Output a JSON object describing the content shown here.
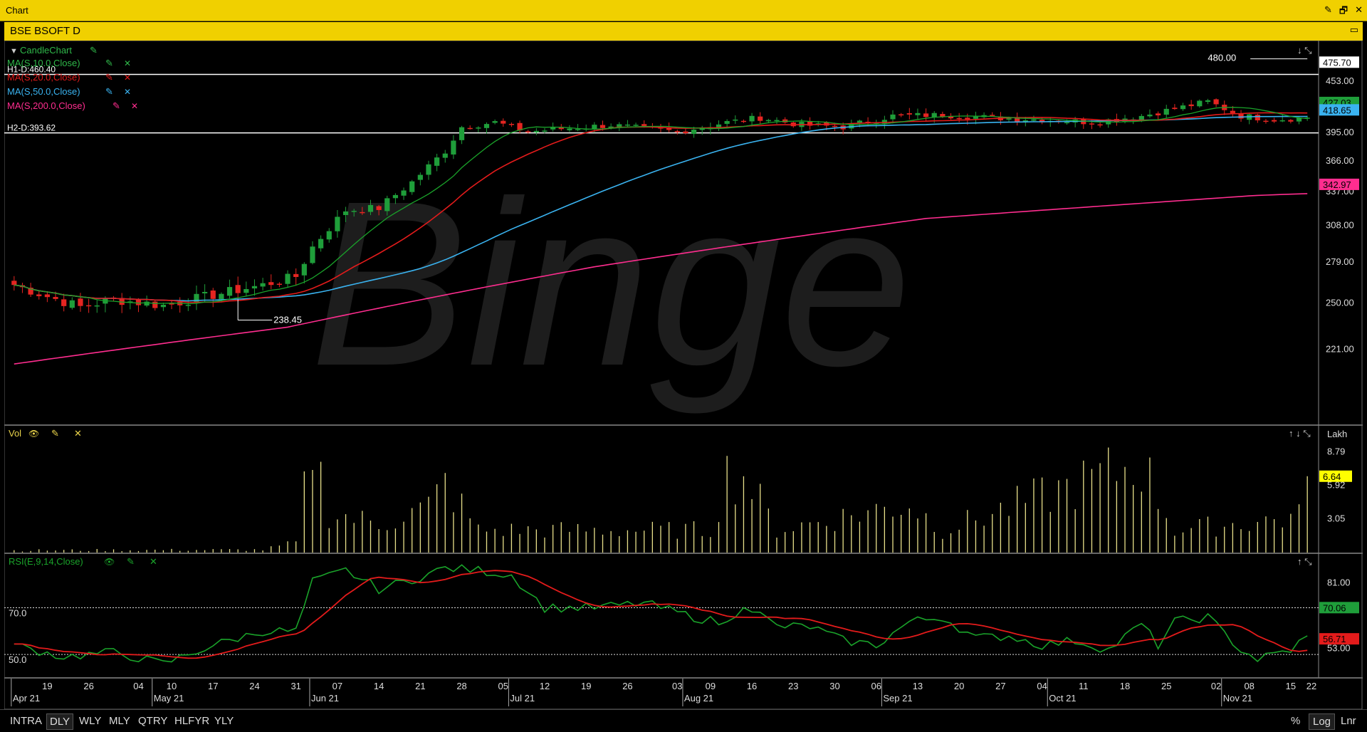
{
  "window": {
    "title": "Chart",
    "controls": [
      "✎",
      "🗗",
      "✕"
    ]
  },
  "chart_header": {
    "title": "BSE BSOFT D",
    "minimize": "▭"
  },
  "watermark": "Binge",
  "colors": {
    "up": "#1f9e3a",
    "down": "#e52521",
    "ma10": "#1aa32a",
    "ma20": "#e31b1b",
    "ma50": "#3ab3f0",
    "ma200": "#ff2d8f",
    "volume": "#e8e08a",
    "rsi": "#1aa32a",
    "rsiSignal": "#e31b1b",
    "grid": "#ffffff"
  },
  "price_panel": {
    "legend": [
      {
        "label": "CandleChart",
        "color": "#2fb84a"
      },
      {
        "label": "MA(S,10.0,Close)",
        "color": "#2fb84a"
      },
      {
        "label": "MA(S,20.0,Close)",
        "color": "#e31b1b"
      },
      {
        "label": "MA(S,50.0,Close)",
        "color": "#3ab3f0"
      },
      {
        "label": "MA(S,200.0,Close)",
        "color": "#ff2d8f"
      }
    ],
    "hlines": [
      {
        "label": "H1-D:460.40",
        "value": 460.4
      },
      {
        "label": "H2-D:393.62",
        "value": 393.62
      }
    ],
    "high_annotation": "480.00",
    "low_annotation": "238.45",
    "axis_ticks": [
      "453.00",
      "395.00",
      "366.00",
      "337.00",
      "308.00",
      "279.00",
      "250.00",
      "221.00"
    ],
    "axis_tick_values": [
      453,
      395,
      366,
      337,
      308,
      279,
      250,
      221
    ],
    "ylim": [
      180,
      504
    ],
    "value_tags": [
      {
        "text": "475.70",
        "value": 475.7,
        "bg": "#ffffff",
        "fg": "#000000"
      },
      {
        "text": "427.03",
        "value": 427.03,
        "bg": "#1f9e3a",
        "fg": "#000000"
      },
      {
        "text": "418.65",
        "value": 418.65,
        "bg": "#3ab3f0",
        "fg": "#000000"
      },
      {
        "text": "342.97",
        "value": 342.97,
        "bg": "#ff2d8f",
        "fg": "#000000"
      }
    ],
    "panel_icons": "↓ ⤡"
  },
  "volume_panel": {
    "legend": "Vol",
    "unit": "Lakh",
    "axis_ticks": [
      "8.79",
      "5.92",
      "3.05"
    ],
    "axis_tick_values": [
      8.79,
      5.92,
      3.05
    ],
    "ylim": [
      0,
      10
    ],
    "value_tag": {
      "text": "6.64",
      "value": 6.64,
      "bg": "#ffff00",
      "fg": "#000000"
    },
    "panel_icons": "↑ ↓ ⤡"
  },
  "rsi_panel": {
    "legend": "RSI(E,9,14,Close)",
    "axis_ticks": [
      "81.00",
      "53.00"
    ],
    "axis_tick_values": [
      81,
      53
    ],
    "ylim": [
      40,
      93
    ],
    "levels": [
      {
        "label": "70.0",
        "value": 70
      },
      {
        "label": "50.0",
        "value": 50
      }
    ],
    "value_tags": [
      {
        "text": "70.06",
        "value": 70.06,
        "bg": "#1f9e3a",
        "fg": "#000000"
      },
      {
        "text": "56.71",
        "value": 56.71,
        "bg": "#e31b1b",
        "fg": "#000000"
      }
    ],
    "panel_icons": "↑ ⤡"
  },
  "x_axis": {
    "labels": [
      {
        "text": "Apr 21",
        "date": "2021-04-13"
      },
      {
        "text": "19",
        "date": "2021-04-19"
      },
      {
        "text": "26",
        "date": "2021-04-26"
      },
      {
        "text": "04",
        "date": "2021-05-04"
      },
      {
        "text": "May 21",
        "date": "2021-05-06"
      },
      {
        "text": "10",
        "date": "2021-05-10"
      },
      {
        "text": "17",
        "date": "2021-05-17"
      },
      {
        "text": "24",
        "date": "2021-05-24"
      },
      {
        "text": "31",
        "date": "2021-05-31"
      },
      {
        "text": "Jun 21",
        "date": "2021-06-02"
      },
      {
        "text": "07",
        "date": "2021-06-07"
      },
      {
        "text": "14",
        "date": "2021-06-14"
      },
      {
        "text": "21",
        "date": "2021-06-21"
      },
      {
        "text": "28",
        "date": "2021-06-28"
      },
      {
        "text": "05",
        "date": "2021-07-05"
      },
      {
        "text": "Jul 21",
        "date": "2021-07-06"
      },
      {
        "text": "12",
        "date": "2021-07-12"
      },
      {
        "text": "19",
        "date": "2021-07-19"
      },
      {
        "text": "26",
        "date": "2021-07-26"
      },
      {
        "text": "03",
        "date": "2021-08-03"
      },
      {
        "text": "Aug 21",
        "date": "2021-08-04"
      },
      {
        "text": "09",
        "date": "2021-08-09"
      },
      {
        "text": "16",
        "date": "2021-08-16"
      },
      {
        "text": "23",
        "date": "2021-08-23"
      },
      {
        "text": "30",
        "date": "2021-08-30"
      },
      {
        "text": "06",
        "date": "2021-09-06"
      },
      {
        "text": "Sep 21",
        "date": "2021-09-07"
      },
      {
        "text": "13",
        "date": "2021-09-13"
      },
      {
        "text": "20",
        "date": "2021-09-20"
      },
      {
        "text": "27",
        "date": "2021-09-27"
      },
      {
        "text": "04",
        "date": "2021-10-04"
      },
      {
        "text": "Oct 21",
        "date": "2021-10-05"
      },
      {
        "text": "11",
        "date": "2021-10-11"
      },
      {
        "text": "18",
        "date": "2021-10-18"
      },
      {
        "text": "25",
        "date": "2021-10-25"
      },
      {
        "text": "02",
        "date": "2021-11-02"
      },
      {
        "text": "Nov 21",
        "date": "2021-11-03"
      },
      {
        "text": "08",
        "date": "2021-11-08"
      },
      {
        "text": "15",
        "date": "2021-11-15"
      },
      {
        "text": "22",
        "date": "2021-11-22"
      }
    ]
  },
  "chart_data": {
    "type": "candlestick",
    "start_date": "2021-04-13",
    "end_date": "2021-11-17",
    "anchors": {
      "close": [
        [
          0,
          262
        ],
        [
          4,
          254
        ],
        [
          8,
          247
        ],
        [
          12,
          252
        ],
        [
          18,
          248
        ],
        [
          24,
          255
        ],
        [
          30,
          262
        ],
        [
          34,
          268
        ],
        [
          36,
          290
        ],
        [
          40,
          320
        ],
        [
          44,
          322
        ],
        [
          48,
          345
        ],
        [
          52,
          375
        ],
        [
          54,
          400
        ],
        [
          58,
          405
        ],
        [
          62,
          395
        ],
        [
          66,
          398
        ],
        [
          72,
          402
        ],
        [
          76,
          398
        ],
        [
          80,
          395
        ],
        [
          86,
          405
        ],
        [
          90,
          410
        ],
        [
          95,
          402
        ],
        [
          100,
          400
        ],
        [
          106,
          412
        ],
        [
          112,
          413
        ],
        [
          118,
          410
        ],
        [
          124,
          408
        ],
        [
          130,
          405
        ],
        [
          136,
          412
        ],
        [
          140,
          420
        ],
        [
          144,
          428
        ],
        [
          148,
          412
        ],
        [
          152,
          408
        ],
        [
          156,
          410
        ],
        [
          160,
          415
        ],
        [
          164,
          412
        ],
        [
          166,
          420
        ],
        [
          168,
          415
        ],
        [
          170,
          402
        ],
        [
          172,
          404
        ],
        [
          176,
          408
        ],
        [
          180,
          414
        ],
        [
          182,
          415
        ],
        [
          185,
          430
        ],
        [
          187,
          452
        ],
        [
          189,
          471
        ]
      ],
      "volume": [
        [
          0,
          0.25
        ],
        [
          30,
          0.3
        ],
        [
          34,
          0.9
        ],
        [
          36,
          9.6
        ],
        [
          38,
          3.5
        ],
        [
          44,
          2.5
        ],
        [
          50,
          4.0
        ],
        [
          52,
          6.0
        ],
        [
          56,
          2.0
        ],
        [
          84,
          2.0
        ],
        [
          86,
          6.8
        ],
        [
          88,
          6.8
        ],
        [
          92,
          2.0
        ],
        [
          108,
          4.3
        ],
        [
          112,
          2.0
        ],
        [
          136,
          7.8
        ],
        [
          140,
          2.0
        ],
        [
          164,
          3.8
        ],
        [
          168,
          1.0
        ],
        [
          184,
          1.0
        ],
        [
          186,
          4.5
        ],
        [
          188,
          1.2
        ],
        [
          189,
          6.64
        ]
      ],
      "ma200": [
        [
          0,
          212
        ],
        [
          33,
          234
        ],
        [
          70,
          275
        ],
        [
          110,
          313
        ],
        [
          150,
          333
        ],
        [
          189,
          342.97
        ]
      ],
      "rsi": [
        [
          0,
          54
        ],
        [
          6,
          49
        ],
        [
          12,
          51
        ],
        [
          18,
          46
        ],
        [
          24,
          54
        ],
        [
          30,
          60
        ],
        [
          34,
          60
        ],
        [
          36,
          81
        ],
        [
          40,
          86
        ],
        [
          44,
          78
        ],
        [
          48,
          82
        ],
        [
          52,
          87
        ],
        [
          56,
          86
        ],
        [
          60,
          84
        ],
        [
          64,
          70
        ],
        [
          70,
          70
        ],
        [
          76,
          72
        ],
        [
          82,
          66
        ],
        [
          86,
          63
        ],
        [
          88,
          72
        ],
        [
          92,
          62
        ],
        [
          96,
          62
        ],
        [
          100,
          56
        ],
        [
          104,
          54
        ],
        [
          108,
          64
        ],
        [
          112,
          66
        ],
        [
          116,
          57
        ],
        [
          120,
          58
        ],
        [
          124,
          54
        ],
        [
          128,
          56
        ],
        [
          132,
          52
        ],
        [
          136,
          63
        ],
        [
          138,
          54
        ],
        [
          140,
          64
        ],
        [
          144,
          66
        ],
        [
          148,
          52
        ],
        [
          150,
          48
        ],
        [
          154,
          52
        ],
        [
          156,
          58
        ],
        [
          160,
          58
        ],
        [
          164,
          58
        ],
        [
          168,
          51
        ],
        [
          172,
          49
        ],
        [
          176,
          52
        ],
        [
          178,
          54
        ],
        [
          182,
          58
        ],
        [
          186,
          58
        ],
        [
          189,
          70.06
        ]
      ]
    },
    "ma_periods": [
      10,
      20,
      50
    ],
    "rsi_signal_period": 9,
    "candle_amplitude": 7
  }
}
